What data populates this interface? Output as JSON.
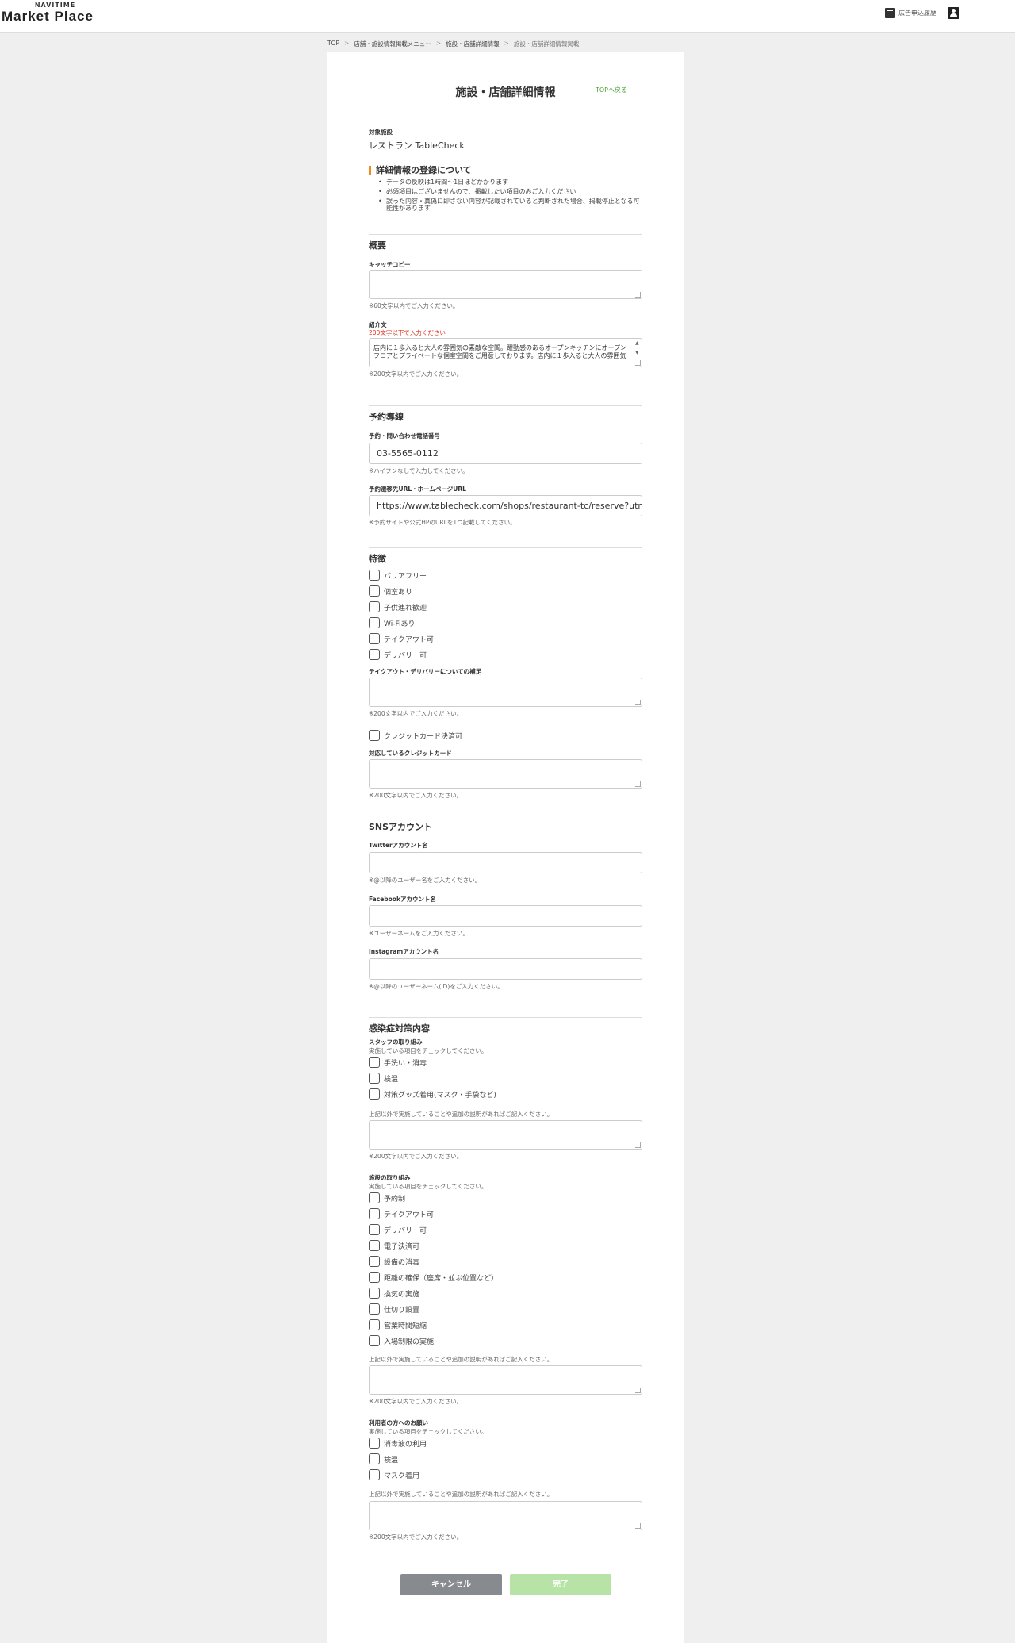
{
  "header": {
    "logo_sub": "NAVITIME",
    "logo_main": "Market Place",
    "ad_history": "広告申込履歴"
  },
  "breadcrumb": {
    "items": [
      "TOP",
      "店舗・施設情報掲載メニュー",
      "施設・店舗詳細情報",
      "施設・店舗詳細情報掲載"
    ]
  },
  "page": {
    "title": "施設・店舗詳細情報",
    "top_link": "TOPへ戻る",
    "target_label": "対象施設",
    "target_value": "レストラン TableCheck"
  },
  "notice": {
    "heading": "詳細情報の登録について",
    "items": [
      "データの反映は1時間〜1日ほどかかります",
      "必須項目はございませんので、掲載したい項目のみご入力ください",
      "誤った内容・真偽に即さない内容が記載されていると判断された場合、掲載停止となる可能性があります"
    ]
  },
  "overview": {
    "heading": "概要",
    "catch_label": "キャッチコピー",
    "catch_hint": "※60文字以内でご入力ください。",
    "intro_label": "紹介文",
    "intro_error": "200文字以下で入力ください",
    "intro_value": "店内に１歩入ると大人の雰囲気の素敵な空間。躍動感のあるオープンキッチンにオープンフロアとプライベートな個室空間をご用意しております。店内に１歩入ると大人の雰囲気",
    "intro_hint": "※200文字以内でご入力ください。"
  },
  "reservation": {
    "heading": "予約導線",
    "phone_label": "予約・問い合わせ電話番号",
    "phone_value": "03-5565-0112",
    "phone_hint": "※ハイフンなしで入力してください。",
    "url_label": "予約遷移先URL・ホームページURL",
    "url_value": "https://www.tablecheck.com/shops/restaurant-tc/reserve?utm",
    "url_hint": "※予約サイトや公式HPのURLを1つ記載してください。"
  },
  "features": {
    "heading": "特徴",
    "options": [
      "バリアフリー",
      "個室あり",
      "子供連れ歓迎",
      "Wi-Fiあり",
      "テイクアウト可",
      "デリバリー可"
    ],
    "takeout_label": "テイクアウト・デリバリーについての補足",
    "takeout_hint": "※200文字以内でご入力ください。",
    "credit_option": "クレジットカード決済可",
    "credit_label": "対応しているクレジットカード",
    "credit_hint": "※200文字以内でご入力ください。"
  },
  "sns": {
    "heading": "SNSアカウント",
    "twitter_label": "Twitterアカウント名",
    "twitter_hint": "※@以降のユーザー名をご入力ください。",
    "facebook_label": "Facebookアカウント名",
    "facebook_hint": "※ユーザーネームをご入力ください。",
    "instagram_label": "Instagramアカウント名",
    "instagram_hint": "※@以降のユーザーネーム(ID)をご入力ください。"
  },
  "infection": {
    "heading": "感染症対策内容",
    "staff_label": "スタッフの取り組み",
    "staff_sub": "実施している項目をチェックしてください。",
    "staff_options": [
      "手洗い・消毒",
      "検温",
      "対策グッズ着用(マスク・手袋など)"
    ],
    "staff_extra": "上記以外で実施していることや追加の説明があればご記入ください。",
    "staff_hint": "※200文字以内でご入力ください。",
    "facility_label": "施設の取り組み",
    "facility_sub": "実施している項目をチェックしてください。",
    "facility_options": [
      "予約制",
      "テイクアウト可",
      "デリバリー可",
      "電子決済可",
      "設備の消毒",
      "距離の確保（座席・並ぶ位置など）",
      "換気の実施",
      "仕切り設置",
      "営業時間短縮",
      "入場制限の実施"
    ],
    "facility_extra": "上記以外で実施していることや追加の説明があればご記入ください。",
    "facility_hint": "※200文字以内でご入力ください。",
    "user_label": "利用者の方へのお願い",
    "user_sub": "実施している項目をチェックしてください。",
    "user_options": [
      "消毒液の利用",
      "検温",
      "マスク着用"
    ],
    "user_extra": "上記以外で実施していることや追加の説明があればご記入ください。",
    "user_hint": "※200文字以内でご入力ください。"
  },
  "buttons": {
    "cancel": "キャンセル",
    "done": "完了"
  }
}
